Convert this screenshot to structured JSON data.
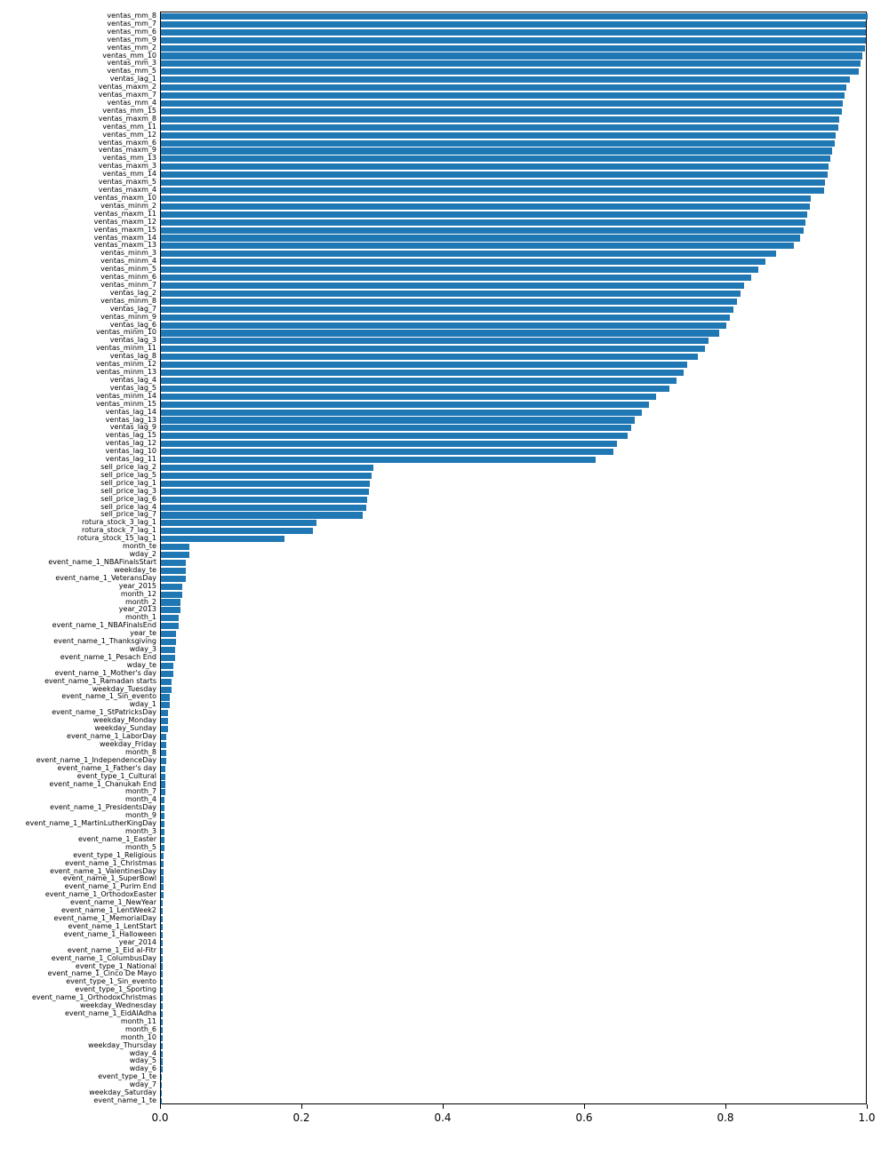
{
  "chart_data": {
    "type": "bar",
    "orientation": "horizontal",
    "title": "",
    "xlabel": "",
    "ylabel": "",
    "xlim": [
      0.0,
      1.0
    ],
    "xticks": [
      0.0,
      0.2,
      0.4,
      0.6,
      0.8,
      1.0
    ],
    "xticklabels": [
      "0.0",
      "0.2",
      "0.4",
      "0.6",
      "0.8",
      "1.0"
    ],
    "bar_color": "#1f77b4",
    "categories": [
      "ventas_mm_8",
      "ventas_mm_7",
      "ventas_mm_6",
      "ventas_mm_9",
      "ventas_mm_2",
      "ventas_mm_10",
      "ventas_mm_3",
      "ventas_mm_5",
      "ventas_lag_1",
      "ventas_maxm_2",
      "ventas_maxm_7",
      "ventas_mm_4",
      "ventas_mm_15",
      "ventas_maxm_8",
      "ventas_mm_11",
      "ventas_mm_12",
      "ventas_maxm_6",
      "ventas_maxm_9",
      "ventas_mm_13",
      "ventas_maxm_3",
      "ventas_mm_14",
      "ventas_maxm_5",
      "ventas_maxm_4",
      "ventas_maxm_10",
      "ventas_minm_2",
      "ventas_maxm_11",
      "ventas_maxm_12",
      "ventas_maxm_15",
      "ventas_maxm_14",
      "ventas_maxm_13",
      "ventas_minm_3",
      "ventas_minm_4",
      "ventas_minm_5",
      "ventas_minm_6",
      "ventas_minm_7",
      "ventas_lag_2",
      "ventas_minm_8",
      "ventas_lag_7",
      "ventas_minm_9",
      "ventas_lag_6",
      "ventas_minm_10",
      "ventas_lag_3",
      "ventas_minm_11",
      "ventas_lag_8",
      "ventas_minm_12",
      "ventas_minm_13",
      "ventas_lag_4",
      "ventas_lag_5",
      "ventas_minm_14",
      "ventas_minm_15",
      "ventas_lag_14",
      "ventas_lag_13",
      "ventas_lag_9",
      "ventas_lag_15",
      "ventas_lag_12",
      "ventas_lag_10",
      "ventas_lag_11",
      "sell_price_lag_2",
      "sell_price_lag_5",
      "sell_price_lag_1",
      "sell_price_lag_3",
      "sell_price_lag_6",
      "sell_price_lag_4",
      "sell_price_lag_7",
      "rotura_stock_3_lag_1",
      "rotura_stock_7_lag_1",
      "rotura_stock_15_lag_1",
      "month_te",
      "wday_2",
      "event_name_1_NBAFinalsStart",
      "weekday_te",
      "event_name_1_VeteransDay",
      "year_2015",
      "month_12",
      "month_2",
      "year_2013",
      "month_1",
      "event_name_1_NBAFinalsEnd",
      "year_te",
      "event_name_1_Thanksgiving",
      "wday_3",
      "event_name_1_Pesach End",
      "wday_te",
      "event_name_1_Mother's day",
      "event_name_1_Ramadan starts",
      "weekday_Tuesday",
      "event_name_1_Sin_evento",
      "wday_1",
      "event_name_1_StPatricksDay",
      "weekday_Monday",
      "weekday_Sunday",
      "event_name_1_LaborDay",
      "weekday_Friday",
      "month_8",
      "event_name_1_IndependenceDay",
      "event_name_1_Father's day",
      "event_type_1_Cultural",
      "event_name_1_Chanukah End",
      "month_7",
      "month_4",
      "event_name_1_PresidentsDay",
      "month_9",
      "event_name_1_MartinLutherKingDay",
      "month_3",
      "event_name_1_Easter",
      "month_5",
      "event_type_1_Religious",
      "event_name_1_Christmas",
      "event_name_1_ValentinesDay",
      "event_name_1_SuperBowl",
      "event_name_1_Purim End",
      "event_name_1_OrthodoxEaster",
      "event_name_1_NewYear",
      "event_name_1_LentWeek2",
      "event_name_1_MemorialDay",
      "event_name_1_LentStart",
      "event_name_1_Halloween",
      "year_2014",
      "event_name_1_Eid al-Fitr",
      "event_name_1_ColumbusDay",
      "event_type_1_National",
      "event_name_1_Cinco De Mayo",
      "event_type_1_Sin_evento",
      "event_type_1_Sporting",
      "event_name_1_OrthodoxChristmas",
      "weekday_Wednesday",
      "event_name_1_EidAlAdha",
      "month_11",
      "month_6",
      "month_10",
      "weekday_Thursday",
      "wday_4",
      "wday_5",
      "wday_6",
      "event_type_1_te",
      "wday_7",
      "weekday_Saturday",
      "event_name_1_te"
    ],
    "values": [
      1.0,
      0.998,
      0.997,
      0.997,
      0.996,
      0.992,
      0.99,
      0.988,
      0.975,
      0.97,
      0.967,
      0.965,
      0.963,
      0.96,
      0.958,
      0.955,
      0.953,
      0.95,
      0.947,
      0.945,
      0.943,
      0.94,
      0.938,
      0.92,
      0.918,
      0.915,
      0.912,
      0.91,
      0.905,
      0.895,
      0.87,
      0.855,
      0.845,
      0.835,
      0.825,
      0.82,
      0.815,
      0.81,
      0.805,
      0.8,
      0.79,
      0.775,
      0.77,
      0.76,
      0.745,
      0.74,
      0.73,
      0.72,
      0.7,
      0.69,
      0.68,
      0.67,
      0.665,
      0.66,
      0.645,
      0.64,
      0.615,
      0.3,
      0.298,
      0.296,
      0.294,
      0.292,
      0.29,
      0.285,
      0.22,
      0.215,
      0.175,
      0.04,
      0.04,
      0.035,
      0.035,
      0.035,
      0.03,
      0.03,
      0.028,
      0.028,
      0.025,
      0.025,
      0.022,
      0.022,
      0.02,
      0.02,
      0.018,
      0.018,
      0.015,
      0.015,
      0.012,
      0.012,
      0.01,
      0.01,
      0.01,
      0.008,
      0.008,
      0.008,
      0.008,
      0.006,
      0.006,
      0.006,
      0.006,
      0.005,
      0.005,
      0.005,
      0.005,
      0.005,
      0.005,
      0.005,
      0.004,
      0.004,
      0.004,
      0.004,
      0.004,
      0.004,
      0.003,
      0.003,
      0.003,
      0.003,
      0.003,
      0.003,
      0.003,
      0.003,
      0.003,
      0.002,
      0.002,
      0.002,
      0.002,
      0.002,
      0.002,
      0.002,
      0.002,
      0.002,
      0.002,
      0.002,
      0.002,
      0.002,
      0.001,
      0.001,
      0.001,
      0.001
    ]
  }
}
